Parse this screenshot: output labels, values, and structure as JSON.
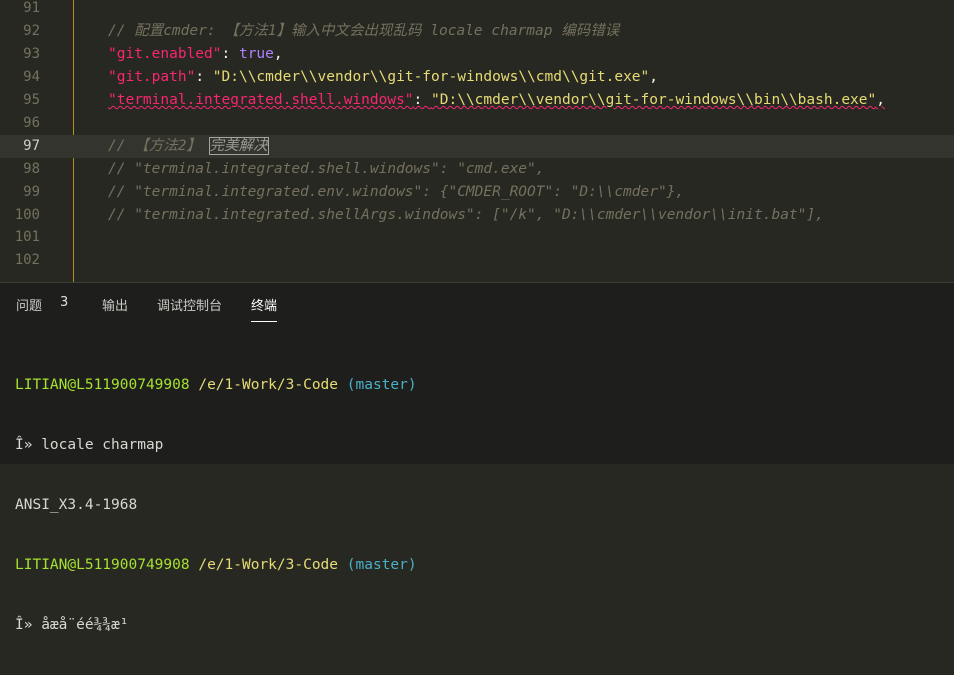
{
  "editor": {
    "lines": [
      {
        "num": "91"
      },
      {
        "num": "92",
        "comment": "// 配置cmder: 【方法1】输入中文会出现乱码 locale charmap 编码错误"
      },
      {
        "num": "93",
        "key": "\"git.enabled\"",
        "colon": ": ",
        "value": "true",
        "tail": ","
      },
      {
        "num": "94",
        "key": "\"git.path\"",
        "colon": ": ",
        "value": "\"D:\\\\cmder\\\\vendor\\\\git-for-windows\\\\cmd\\\\git.exe\"",
        "tail": ","
      },
      {
        "num": "95",
        "key": "\"terminal.integrated.shell.windows\"",
        "colon": ": ",
        "value": "\"D:\\\\cmder\\\\vendor\\\\git-for-windows\\\\bin\\\\bash.exe\"",
        "tail": ","
      },
      {
        "num": "96"
      },
      {
        "num": "97",
        "comment": "// 【方法2】 ",
        "selected": "完美解决"
      },
      {
        "num": "98",
        "comment": "// \"terminal.integrated.shell.windows\": \"cmd.exe\","
      },
      {
        "num": "99",
        "comment": "// \"terminal.integrated.env.windows\": {\"CMDER_ROOT\": \"D:\\\\cmder\"},"
      },
      {
        "num": "100",
        "comment": "// \"terminal.integrated.shellArgs.windows\": [\"/k\", \"D:\\\\cmder\\\\vendor\\\\init.bat\"],"
      },
      {
        "num": "101"
      },
      {
        "num": "102"
      }
    ]
  },
  "panel": {
    "tabs": [
      {
        "label": "问题"
      },
      {
        "label": "输出"
      },
      {
        "label": "调试控制台"
      },
      {
        "label": "终端"
      }
    ],
    "problems_count": "3",
    "active_tab": "终端"
  },
  "terminal": {
    "user1": "LITIAN@L511900749908",
    "path1": "/e/1-Work/3-Code",
    "branch1": "(master)",
    "cmd1": "Î» locale charmap",
    "out1": "ANSI_X3.4-1968",
    "user2": "LITIAN@L511900749908",
    "path2": "/e/1-Work/3-Code",
    "branch2": "(master)",
    "cmd2": "Î» åæå¨éé¾¾æ¹"
  },
  "colors": {
    "background": "#272822",
    "gutter_line": "#b98f16",
    "key": "#f92672",
    "string": "#e6db74",
    "escape": "#ae81ff",
    "comment": "#75715e",
    "prompt_user": "#a6e22e",
    "prompt_branch": "#4ab0c6"
  }
}
